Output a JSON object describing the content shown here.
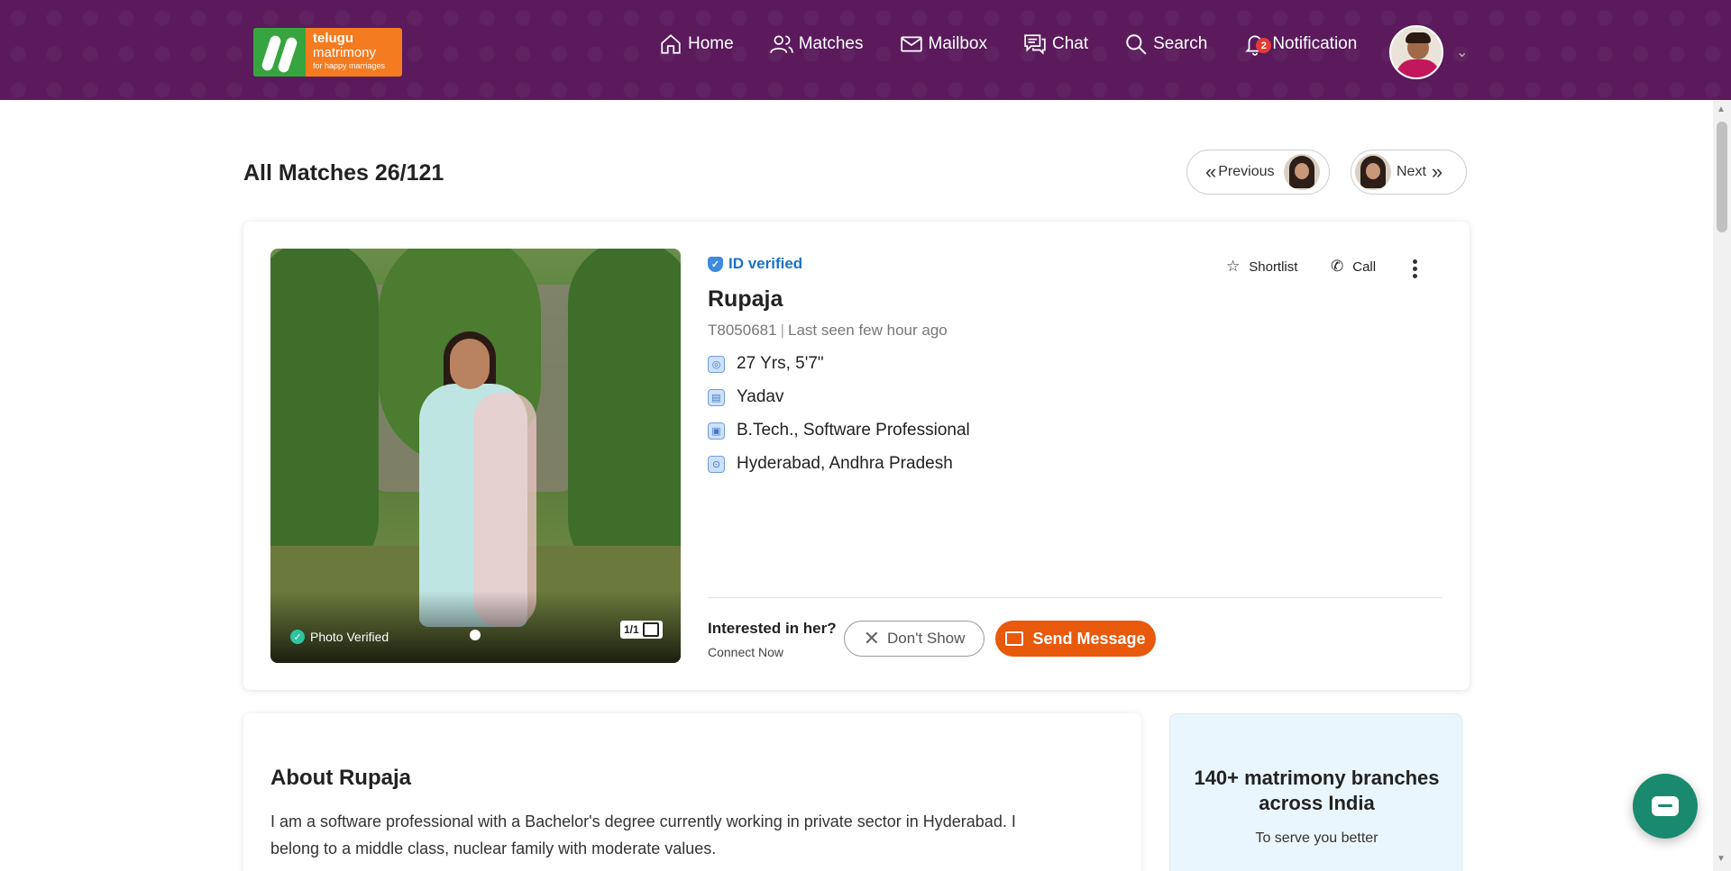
{
  "header": {
    "logo": {
      "line1": "telugu",
      "line2": "matrimony",
      "tagline": "for happy marriages"
    },
    "nav": [
      {
        "label": "Home",
        "icon": "home-icon"
      },
      {
        "label": "Matches",
        "icon": "users-icon"
      },
      {
        "label": "Mailbox",
        "icon": "mail-icon"
      },
      {
        "label": "Chat",
        "icon": "chat-icon"
      },
      {
        "label": "Search",
        "icon": "search-icon"
      },
      {
        "label": "Notification",
        "icon": "bell-icon",
        "badge": "2"
      }
    ],
    "colors": {
      "background": "#5a1a5c",
      "logo_orange": "#f47b20",
      "logo_green": "#37a53f"
    }
  },
  "page": {
    "title": "All Matches 26/121",
    "previous_label": "Previous",
    "next_label": "Next"
  },
  "profile": {
    "id_verified": "ID verified",
    "name": "Rupaja",
    "member_id": "T8050681",
    "last_seen": "Last seen few hour ago",
    "details": [
      {
        "icon": "age-icon",
        "text": "27 Yrs, 5'7\""
      },
      {
        "icon": "caste-icon",
        "text": "Yadav"
      },
      {
        "icon": "education-icon",
        "text": "B.Tech., Software Professional"
      },
      {
        "icon": "location-icon",
        "text": "Hyderabad, Andhra Pradesh"
      }
    ],
    "photo_verified": "Photo Verified",
    "photo_counter": "1/1",
    "actions": {
      "shortlist": "Shortlist",
      "call": "Call"
    },
    "interest_question": "Interested in her?",
    "connect_now": "Connect Now",
    "dont_show": "Don't Show",
    "send_message": "Send Message",
    "accent": "#e8590c"
  },
  "about": {
    "title": "About Rupaja",
    "text": "I am a software professional with a Bachelor's degree currently working in private sector in Hyderabad. I belong to a middle class, nuclear family with moderate values."
  },
  "promo": {
    "title": "140+ matrimony branches across India",
    "subtitle": "To serve you better"
  }
}
